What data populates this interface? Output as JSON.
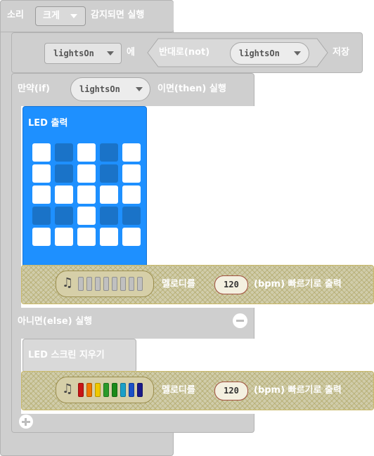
{
  "event": {
    "label_prefix": "소리",
    "level": "크게",
    "label_suffix": "감지되면 실행"
  },
  "assign": {
    "variable": "lightsOn",
    "particle": "에",
    "not_label": "반대로(not)",
    "not_variable": "lightsOn",
    "store": "저장"
  },
  "if_block": {
    "label": "만약(if)",
    "condition_variable": "lightsOn",
    "then_label": "이면(then) 실행",
    "else_label": "아니면(else) 실행"
  },
  "led_show": {
    "label": "LED 출력",
    "grid": [
      [
        1,
        0,
        1,
        0,
        1
      ],
      [
        1,
        0,
        1,
        0,
        1
      ],
      [
        1,
        1,
        1,
        1,
        1
      ],
      [
        0,
        0,
        1,
        0,
        0
      ],
      [
        1,
        1,
        1,
        1,
        1
      ]
    ]
  },
  "melody_1": {
    "label": "멜로디를",
    "tempo": "120",
    "unit": "(bpm) 빠르기로 출력",
    "colors": [
      "#c0c0c0",
      "#c0c0c0",
      "#c0c0c0",
      "#c0c0c0",
      "#c0c0c0",
      "#c0c0c0",
      "#c0c0c0",
      "#c0c0c0"
    ]
  },
  "clear_screen": {
    "label": "LED 스크린 지우기"
  },
  "melody_2": {
    "label": "멜로디를",
    "tempo": "120",
    "unit": "(bpm) 빠르기로 출력",
    "colors": [
      "#c81414",
      "#f07800",
      "#f0c800",
      "#2a9a2a",
      "#1a8a1a",
      "#1aa0c8",
      "#1a50c8",
      "#1a1a8a"
    ]
  }
}
